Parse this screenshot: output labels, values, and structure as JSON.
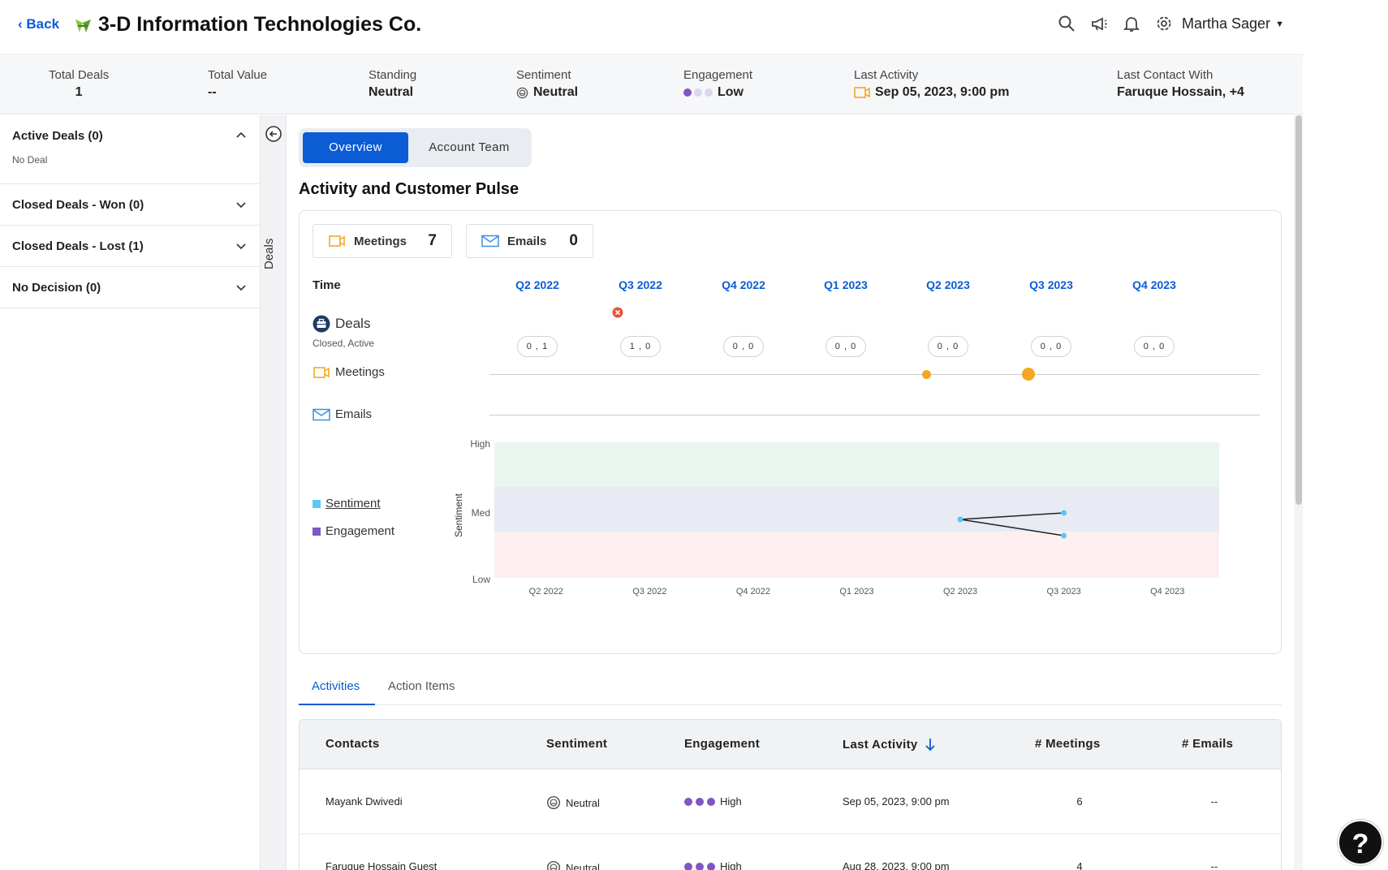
{
  "header": {
    "back_label": "Back",
    "title": "3-D Information Technologies Co.",
    "icons": [
      "search-icon",
      "megaphone-icon",
      "bell-icon",
      "gear-icon"
    ],
    "user_name": "Martha Sager"
  },
  "summary": {
    "total_deals": {
      "label": "Total Deals",
      "value": "1"
    },
    "total_value": {
      "label": "Total Value",
      "value": "--"
    },
    "standing": {
      "label": "Standing",
      "value": "Neutral"
    },
    "sentiment": {
      "label": "Sentiment",
      "value": "Neutral"
    },
    "engagement": {
      "label": "Engagement",
      "value": "Low"
    },
    "last_activity": {
      "label": "Last Activity",
      "value": "Sep 05, 2023, 9:00 pm"
    },
    "last_contact": {
      "label": "Last Contact With",
      "value": "Faruque Hossain, +4"
    }
  },
  "sidebar": {
    "sections": [
      {
        "label": "Active Deals (0)",
        "sub": "No Deal",
        "expanded": true
      },
      {
        "label": "Closed Deals - Won (0)",
        "expanded": false
      },
      {
        "label": "Closed Deals - Lost (1)",
        "expanded": false
      },
      {
        "label": "No Decision (0)",
        "expanded": false
      }
    ],
    "rail_label": "Deals"
  },
  "tabs": {
    "overview": "Overview",
    "account_team": "Account Team"
  },
  "pulse": {
    "title": "Activity and Customer Pulse",
    "meetings": {
      "label": "Meetings",
      "count": "7"
    },
    "emails": {
      "label": "Emails",
      "count": "0"
    },
    "time_label": "Time",
    "quarters": [
      "Q2 2022",
      "Q3 2022",
      "Q4 2022",
      "Q1 2023",
      "Q2 2023",
      "Q3 2023",
      "Q4 2023"
    ],
    "deals_label": "Deals",
    "deals_sub": "Closed, Active",
    "deal_pills": [
      "0 , 1",
      "1 , 0",
      "0 , 0",
      "0 , 0",
      "0 , 0",
      "0 , 0",
      "0 , 0"
    ],
    "meetings_row_label": "Meetings",
    "emails_row_label": "Emails",
    "legend_sentiment": "Sentiment",
    "legend_engagement": "Engagement",
    "colors": {
      "accent": "#0b5cd5",
      "meeting": "#f5a623",
      "sentiment": "#5bc8f5",
      "engagement": "#7e57c2",
      "high_band": "#e8f6ef",
      "med_band": "#e8ebf4",
      "low_band": "#fdefef"
    }
  },
  "chart_data": {
    "type": "line",
    "x": [
      "Q2 2022",
      "Q3 2022",
      "Q4 2022",
      "Q1 2023",
      "Q2 2023",
      "Q3 2023",
      "Q4 2023"
    ],
    "ylabel": "Sentiment",
    "y_ticks": [
      "Low",
      "Med",
      "High"
    ],
    "series": [
      {
        "name": "Sentiment",
        "points": [
          {
            "x": "Q2 2023",
            "y": 1.9
          },
          {
            "x": "Q3 2023",
            "y": 2.0
          }
        ]
      },
      {
        "name": "Engagement",
        "points": [
          {
            "x": "Q2 2023",
            "y": 1.9
          },
          {
            "x": "Q3 2023",
            "y": 1.65
          }
        ]
      }
    ],
    "meetings_markers": [
      {
        "x": "Q2 2023",
        "size": "small"
      },
      {
        "x": "Q3 2023",
        "size": "large"
      }
    ],
    "closed_deal_marker": "Q3 2022"
  },
  "activity_tabs": {
    "activities": "Activities",
    "action_items": "Action Items"
  },
  "table": {
    "headers": [
      "Contacts",
      "Sentiment",
      "Engagement",
      "Last Activity",
      "# Meetings",
      "# Emails"
    ],
    "rows": [
      {
        "contact": "Mayank Dwivedi",
        "sentiment": "Neutral",
        "engagement": "High",
        "last_activity": "Sep 05, 2023, 9:00 pm",
        "meetings": "6",
        "emails": "--"
      },
      {
        "contact": "Faruque Hossain Guest",
        "sentiment": "Neutral",
        "engagement": "High",
        "last_activity": "Aug 28, 2023, 9:00 pm",
        "meetings": "4",
        "emails": "--"
      }
    ]
  },
  "help_label": "?"
}
